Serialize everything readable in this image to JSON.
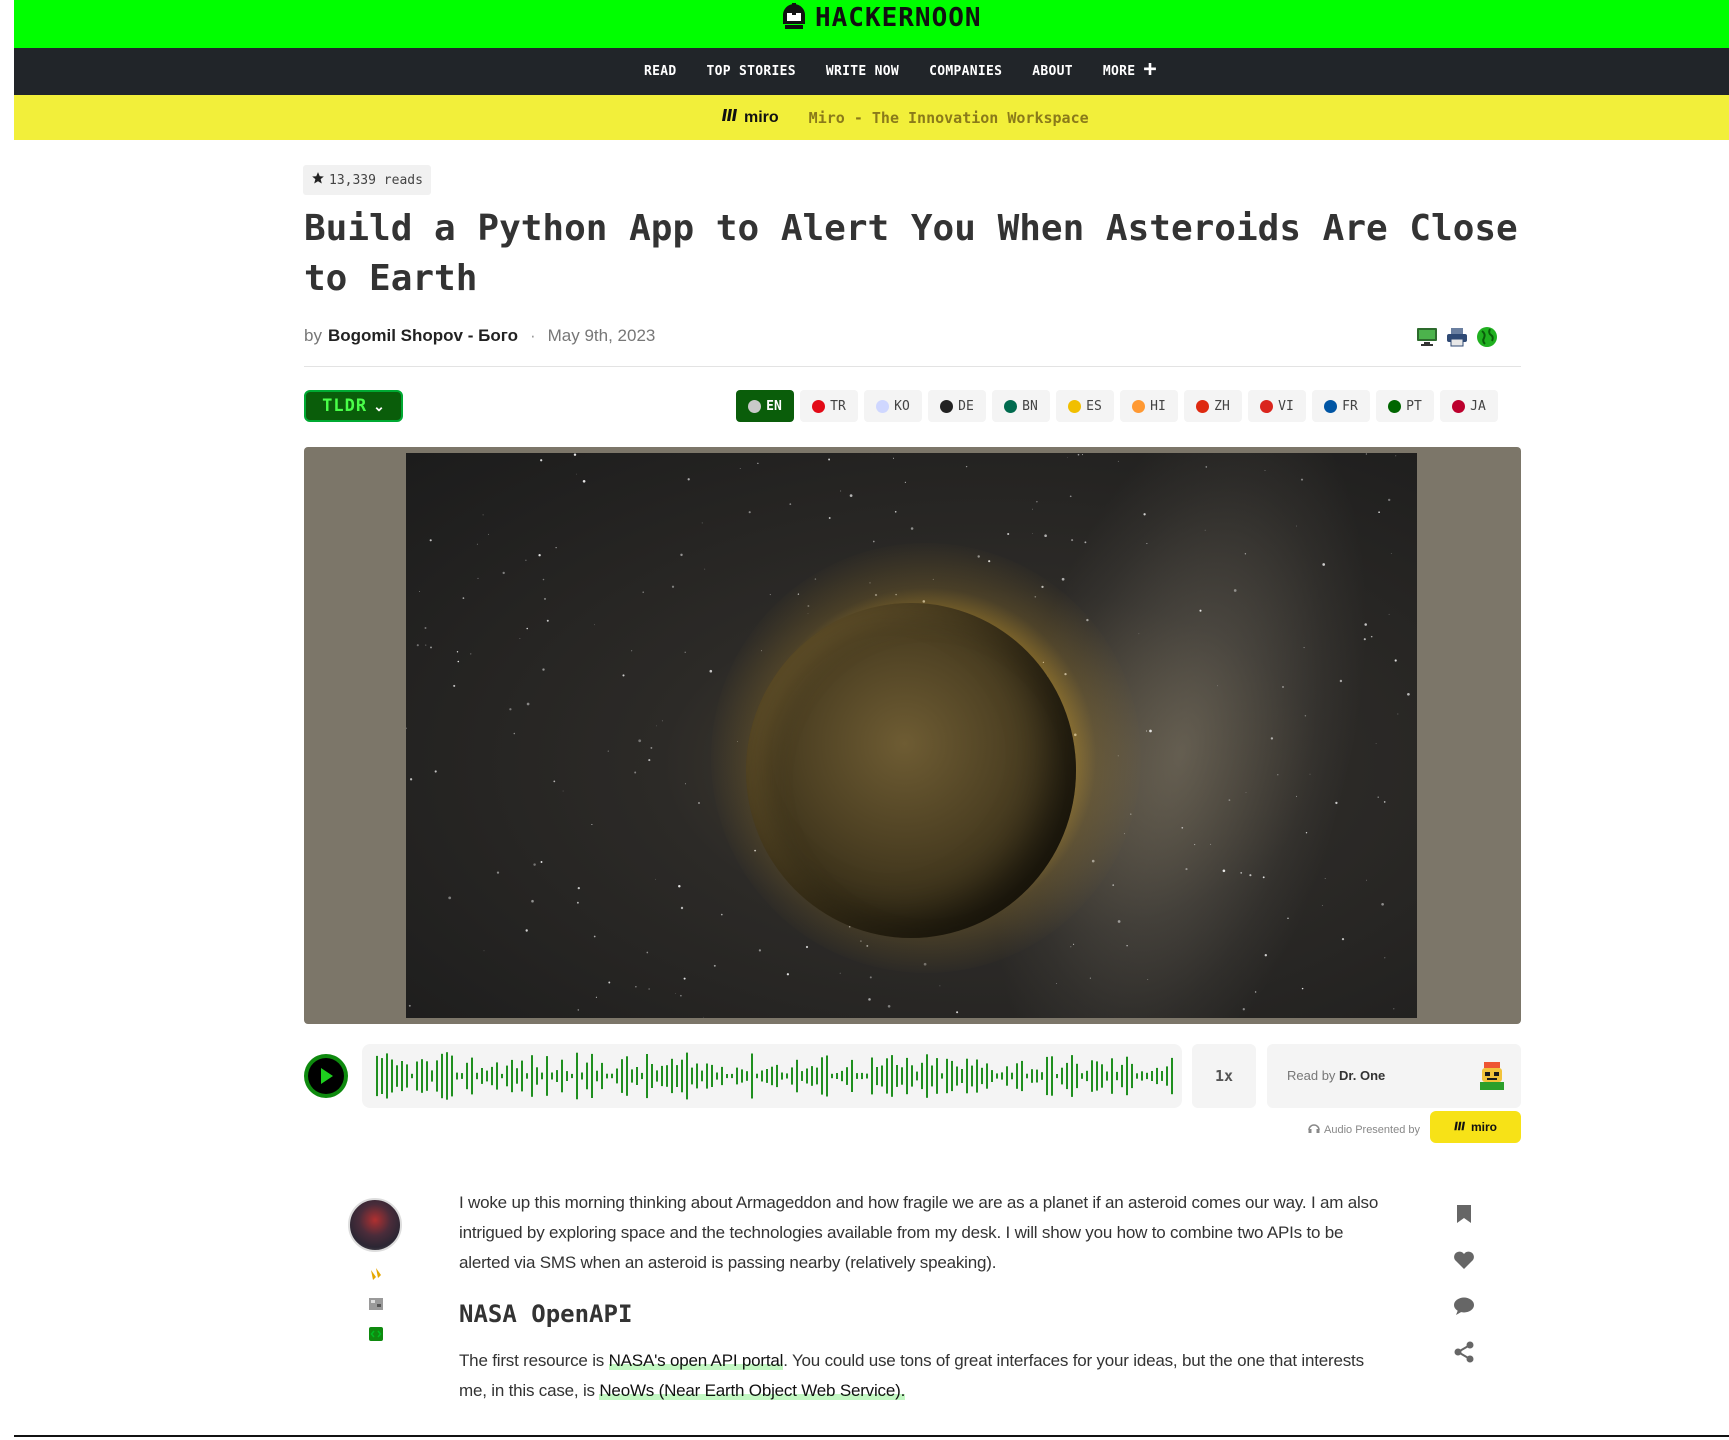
{
  "brand": {
    "name": "HACKERNOON"
  },
  "nav": {
    "items": [
      "READ",
      "TOP STORIES",
      "WRITE NOW",
      "COMPANIES",
      "ABOUT"
    ],
    "more_label": "MORE"
  },
  "sponsor": {
    "logo": "miro",
    "tagline": "Miro - The Innovation Workspace"
  },
  "article": {
    "reads": "13,339 reads",
    "title": "Build a Python App to Alert You When Asteroids Are Close to Earth",
    "by": "by",
    "author": "Bogomil Shopov - Бого",
    "date": "May 9th, 2023",
    "tldr": "TLDR"
  },
  "languages": [
    {
      "code": "EN",
      "active": true,
      "color": "#c9c9c9"
    },
    {
      "code": "TR",
      "active": false,
      "color": "#e30a17"
    },
    {
      "code": "KO",
      "active": false,
      "color": "#cfd7ff"
    },
    {
      "code": "DE",
      "active": false,
      "color": "#222222"
    },
    {
      "code": "BN",
      "active": false,
      "color": "#006a4e"
    },
    {
      "code": "ES",
      "active": false,
      "color": "#f1bf00"
    },
    {
      "code": "HI",
      "active": false,
      "color": "#ff9933"
    },
    {
      "code": "ZH",
      "active": false,
      "color": "#de2910"
    },
    {
      "code": "VI",
      "active": false,
      "color": "#da251d"
    },
    {
      "code": "FR",
      "active": false,
      "color": "#0055a4"
    },
    {
      "code": "PT",
      "active": false,
      "color": "#006600"
    },
    {
      "code": "JA",
      "active": false,
      "color": "#bc002d"
    }
  ],
  "audio": {
    "speed": "1x",
    "read_by": "Read by",
    "reader": "Dr. One",
    "presented_by": "Audio Presented by",
    "sponsor": "miro"
  },
  "content": {
    "intro": "I woke up this morning thinking about Armageddon and how fragile we are as a planet if an asteroid comes our way. I am also intrigued by exploring space and the technologies available from my desk. I will show you how to combine two APIs to be alerted via SMS when an asteroid is passing nearby (relatively speaking).",
    "heading": "NASA OpenAPI",
    "p2_before": "The first resource is ",
    "p2_link1": "NASA's open API portal",
    "p2_middle": ". You could use tons of great interfaces for your ideas, but the one that interests me, in this case, is ",
    "p2_link2": "NeoWs (Near Earth Object Web Service)."
  },
  "colors": {
    "brand_green": "#00ff00",
    "dark": "#212529",
    "sponsor_yellow": "#f2ef3a",
    "accent_green": "#0a5d0a"
  },
  "icons": [
    "hackernoon-helmet-icon",
    "plus-icon",
    "miro-icon",
    "star-icon",
    "monitor-icon",
    "print-icon",
    "globe-icon",
    "play-icon",
    "headphones-icon",
    "bookmark-icon",
    "heart-icon",
    "comment-icon",
    "share-icon"
  ]
}
